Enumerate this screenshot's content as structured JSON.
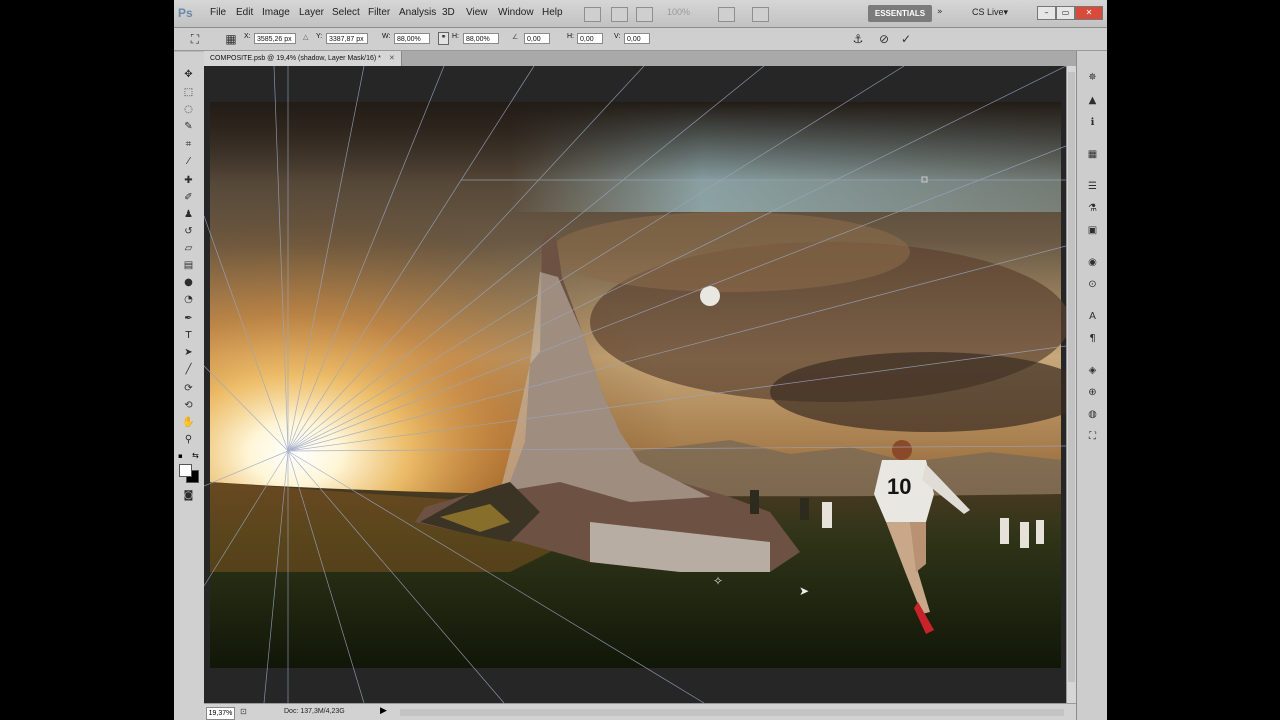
{
  "app": {
    "logo": "Ps"
  },
  "menus": [
    "File",
    "Edit",
    "Image",
    "Layer",
    "Select",
    "Filter",
    "Analysis",
    "3D",
    "View",
    "Window",
    "Help"
  ],
  "menubar": {
    "zoom_value": "100%",
    "workspace": "ESSENTIALS",
    "workspace_arrow": "»",
    "cs_live": "CS Live▾",
    "min": "–",
    "restore": "▭",
    "close": "✕"
  },
  "options": {
    "x_label": "X:",
    "x_value": "3585,26 px",
    "y_label": "Y:",
    "y_value": "3387,87 px",
    "w_label": "W:",
    "w_value": "88,00%",
    "h_label": "H:",
    "h_value": "88,00%",
    "angle_value": "0,00",
    "hskew_label": "H:",
    "hskew_value": "0,00",
    "vskew_label": "V:",
    "vskew_value": "0,00",
    "cancel_icon": "⊘",
    "commit_icon": "✓"
  },
  "document": {
    "tab_title": "COMPOSITE.psb @ 19,4% (shadow, Layer Mask/16) *",
    "tab_close": "✕"
  },
  "status": {
    "zoom": "19,37%",
    "doc_info": "Doc: 137,3M/4,23G",
    "arrow": "▶"
  },
  "artwork": {
    "jersey_number": "10"
  },
  "colors": {
    "ui_bg": "#b9b9b9",
    "canvas_bg": "#262626",
    "workspace_button": "#7b7b7b"
  },
  "tool_icons": [
    "move-tool-icon",
    "marquee-tool-icon",
    "lasso-tool-icon",
    "quick-select-tool-icon",
    "crop-tool-icon",
    "eyedropper-tool-icon",
    "healing-brush-icon",
    "brush-tool-icon",
    "clone-stamp-icon",
    "history-brush-icon",
    "eraser-tool-icon",
    "gradient-tool-icon",
    "blur-tool-icon",
    "dodge-tool-icon",
    "pen-tool-icon",
    "type-tool-icon",
    "path-select-icon",
    "shape-tool-icon",
    "3d-rotate-icon",
    "3d-orbit-icon",
    "hand-tool-icon",
    "zoom-tool-icon"
  ],
  "dock_icons": [
    "navigator-icon",
    "histogram-icon",
    "info-icon",
    "swatches-icon",
    "adjustments-icon",
    "styles-icon",
    "masks-icon",
    "brushes-icon",
    "clone-source-icon",
    "character-icon",
    "paragraph-icon",
    "layers-icon",
    "channels-icon",
    "paths-icon",
    "transform-icon"
  ]
}
